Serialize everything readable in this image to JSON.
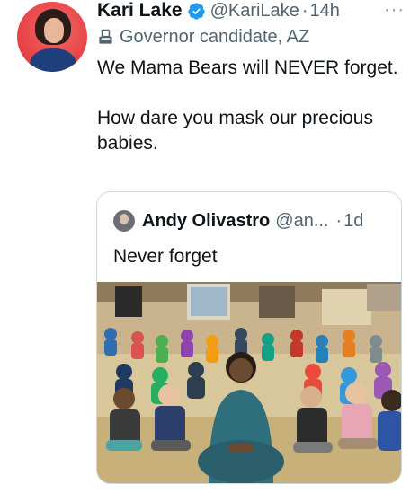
{
  "tweet": {
    "author_name": "Kari Lake",
    "handle": "@KariLake",
    "separator": "·",
    "time": "14h",
    "more_label": "···",
    "label": "Governor candidate, AZ",
    "text_lines": [
      "We Mama Bears will NEVER forget.",
      "How dare you mask our precious babies."
    ]
  },
  "quoted": {
    "author_name": "Andy Olivastro",
    "handle": "@an...",
    "separator": "·",
    "time": "1d",
    "text": "Never forget"
  },
  "icons": {
    "avatar": "profile-photo",
    "verified": "verified-badge-icon",
    "label": "ballot-box-icon",
    "more": "more-options-icon"
  },
  "colors": {
    "verified_blue": "#1d9bf0",
    "secondary_text": "#536471",
    "border": "#cfd9de"
  }
}
